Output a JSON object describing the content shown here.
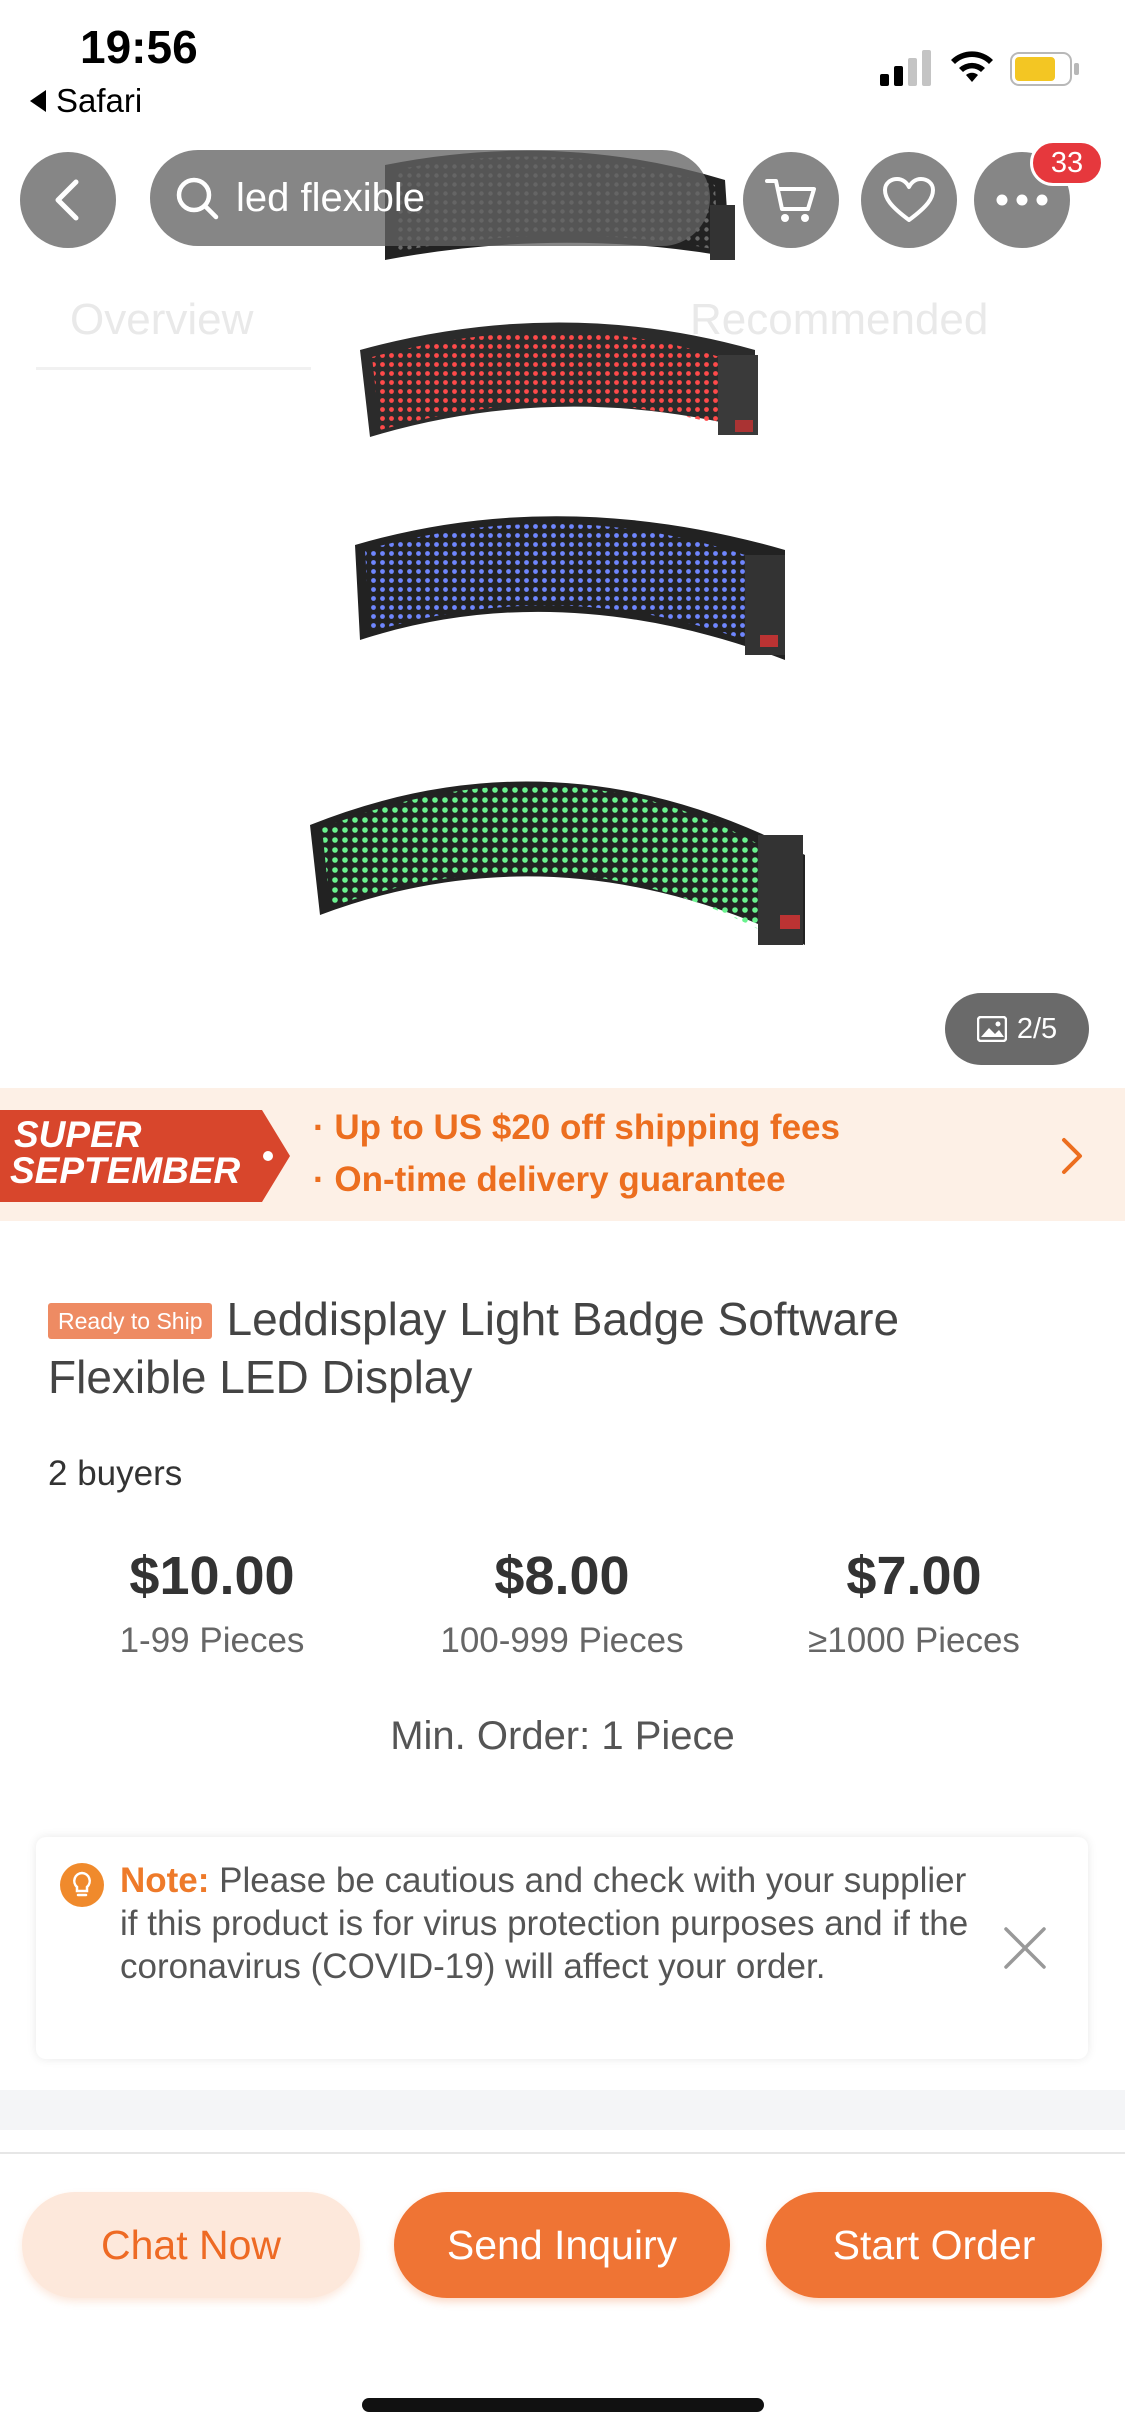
{
  "status_bar": {
    "time": "19:56",
    "back_app": "Safari",
    "signal_icon": "cellular-signal-icon",
    "wifi_icon": "wifi-icon",
    "battery_icon": "battery-icon",
    "battery_color": "#f3c623"
  },
  "nav": {
    "search_query": "led flexible",
    "cart_icon": "cart-icon",
    "favorite_icon": "heart-icon",
    "more_icon": "more-dots-icon",
    "notification_count": "33"
  },
  "ghost_tabs": [
    "Overview",
    "Recommended"
  ],
  "gallery": {
    "counter": "2/5",
    "strip_colors": [
      "#3a3a3a",
      "#e03535",
      "#3b53ff",
      "#3ed26a"
    ]
  },
  "promo": {
    "logo_line1": "SUPER",
    "logo_line2": "SEPTEMBER",
    "line1": "· Up to US $20 off shipping fees",
    "line2": "· On-time delivery guarantee",
    "accent_color": "#ec6e1f"
  },
  "product": {
    "badge": "Ready to Ship",
    "title": "Leddisplay Light Badge Software Flexible LED Display",
    "buyers": "2 buyers",
    "prices": [
      {
        "price": "$10.00",
        "qty": "1-99 Pieces"
      },
      {
        "price": "$8.00",
        "qty": "100-999 Pieces"
      },
      {
        "price": "$7.00",
        "qty": "≥1000 Pieces"
      }
    ],
    "min_order": "Min. Order: 1 Piece"
  },
  "note": {
    "label": "Note:",
    "text": " Please be cautious and check with your supplier if this product is for virus protection purposes and if the coronavirus (COVID-19) will affect your order."
  },
  "actions": {
    "chat": "Chat Now",
    "inquiry": "Send Inquiry",
    "order": "Start Order"
  },
  "colors": {
    "primary": "#ef7434",
    "primary_light": "#fde8db",
    "badge_red": "#e6383d"
  }
}
